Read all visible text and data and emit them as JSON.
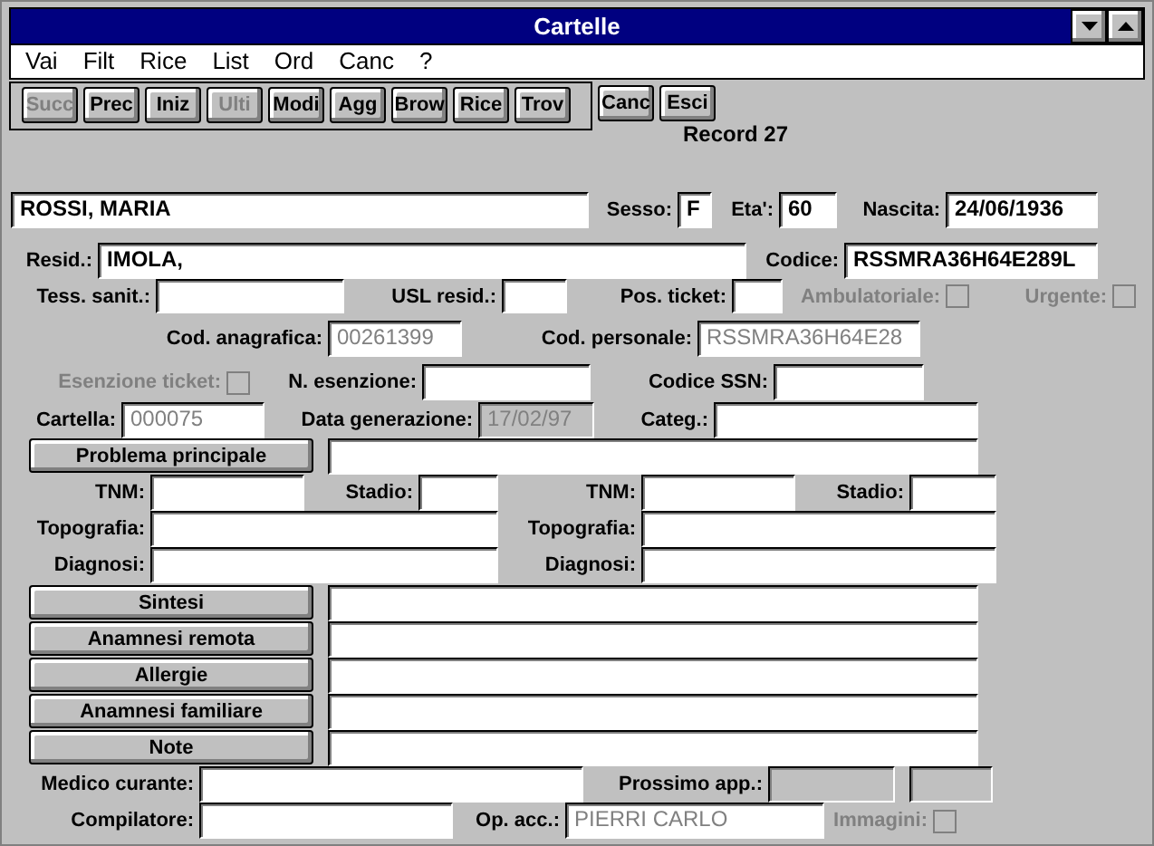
{
  "window": {
    "title": "Cartelle"
  },
  "menu": [
    {
      "label": "Vai"
    },
    {
      "label": "Filt"
    },
    {
      "label": "Rice"
    },
    {
      "label": "List"
    },
    {
      "label": "Ord"
    },
    {
      "label": "Canc"
    },
    {
      "label": "?"
    }
  ],
  "toolbar": {
    "grouped": [
      {
        "label": "Succ",
        "disabled": true
      },
      {
        "label": "Prec",
        "disabled": false
      },
      {
        "label": "Iniz",
        "disabled": false
      },
      {
        "label": "Ulti",
        "disabled": true
      },
      {
        "label": "Modi",
        "disabled": false
      },
      {
        "label": "Agg",
        "disabled": false
      },
      {
        "label": "Brow",
        "disabled": false
      },
      {
        "label": "Rice",
        "disabled": false
      },
      {
        "label": "Trov",
        "disabled": false
      }
    ],
    "separate": [
      {
        "label": "Canc",
        "disabled": false
      },
      {
        "label": "Esci",
        "disabled": false
      }
    ]
  },
  "record": "Record 27",
  "rows": [
    [
      {
        "kind": "field",
        "value": "ROSSI, MARIA"
      },
      {
        "kind": "label",
        "text": "Sesso:"
      },
      {
        "kind": "field",
        "value": "F"
      },
      {
        "kind": "label",
        "text": "Eta':"
      },
      {
        "kind": "field",
        "value": "60"
      },
      {
        "kind": "label",
        "text": "Nascita:"
      },
      {
        "kind": "field",
        "value": "24/06/1936"
      }
    ],
    [
      {
        "kind": "label",
        "text": "Resid.:"
      },
      {
        "kind": "field",
        "value": "IMOLA,"
      },
      {
        "kind": "label",
        "text": "Codice:"
      },
      {
        "kind": "field",
        "value": "RSSMRA36H64E289L"
      }
    ],
    [
      {
        "kind": "label",
        "text": "Tess. sanit.:"
      },
      {
        "kind": "field"
      },
      {
        "kind": "label",
        "text": "USL resid.:"
      },
      {
        "kind": "field"
      },
      {
        "kind": "label",
        "text": "Pos. ticket:"
      },
      {
        "kind": "field"
      },
      {
        "kind": "label",
        "text": "Ambulatoriale:",
        "disabled": true
      },
      {
        "kind": "checkbox",
        "checked": false,
        "disabled": true
      },
      {
        "kind": "label",
        "text": "Urgente:",
        "disabled": true
      },
      {
        "kind": "checkbox",
        "checked": false,
        "disabled": true
      }
    ],
    [
      {
        "kind": "label",
        "text": "Cod. anagrafica:"
      },
      {
        "kind": "field",
        "value": "00261399",
        "readonly": true
      },
      {
        "kind": "label",
        "text": "Cod. personale:"
      },
      {
        "kind": "field",
        "value": "RSSMRA36H64E28",
        "readonly": true
      }
    ],
    [
      {
        "kind": "label",
        "text": "Esenzione ticket:",
        "disabled": true
      },
      {
        "kind": "checkbox",
        "checked": false,
        "disabled": true
      },
      {
        "kind": "label",
        "text": "N. esenzione:"
      },
      {
        "kind": "field"
      },
      {
        "kind": "label",
        "text": "Codice SSN:"
      },
      {
        "kind": "field"
      }
    ],
    [
      {
        "kind": "label",
        "text": "Cartella:"
      },
      {
        "kind": "field",
        "value": "000075",
        "readonly": true
      },
      {
        "kind": "label",
        "text": "Data generazione:"
      },
      {
        "kind": "field",
        "value": "17/02/97",
        "disabled": true
      },
      {
        "kind": "label",
        "text": "Categ.:"
      },
      {
        "kind": "field"
      }
    ],
    [
      {
        "kind": "button",
        "label": "Problema principale"
      },
      {
        "kind": "field"
      }
    ],
    [
      {
        "kind": "label",
        "text": "TNM:"
      },
      {
        "kind": "field"
      },
      {
        "kind": "label",
        "text": "Stadio:"
      },
      {
        "kind": "field"
      },
      {
        "kind": "label",
        "text": "TNM:"
      },
      {
        "kind": "field"
      },
      {
        "kind": "label",
        "text": "Stadio:"
      },
      {
        "kind": "field"
      }
    ],
    [
      {
        "kind": "label",
        "text": "Topografia:"
      },
      {
        "kind": "field"
      },
      {
        "kind": "label",
        "text": "Topografia:"
      },
      {
        "kind": "field"
      }
    ],
    [
      {
        "kind": "label",
        "text": "Diagnosi:"
      },
      {
        "kind": "field"
      },
      {
        "kind": "label",
        "text": "Diagnosi:"
      },
      {
        "kind": "field"
      }
    ],
    [
      {
        "kind": "button",
        "label": "Sintesi"
      },
      {
        "kind": "field"
      }
    ],
    [
      {
        "kind": "button",
        "label": "Anamnesi remota"
      },
      {
        "kind": "field"
      }
    ],
    [
      {
        "kind": "button",
        "label": "Allergie"
      },
      {
        "kind": "field"
      }
    ],
    [
      {
        "kind": "button",
        "label": "Anamnesi familiare"
      },
      {
        "kind": "field"
      }
    ],
    [
      {
        "kind": "button",
        "label": "Note"
      },
      {
        "kind": "field"
      }
    ],
    [
      {
        "kind": "label",
        "text": "Medico curante:"
      },
      {
        "kind": "field"
      },
      {
        "kind": "label",
        "text": "Prossimo app.:"
      },
      {
        "kind": "field",
        "disabled": true
      },
      {
        "kind": "field",
        "disabled": true
      }
    ],
    [
      {
        "kind": "label",
        "text": "Compilatore:"
      },
      {
        "kind": "field"
      },
      {
        "kind": "label",
        "text": "Op. acc.:"
      },
      {
        "kind": "field",
        "value": "PIERRI CARLO",
        "readonly": true
      },
      {
        "kind": "label",
        "text": "Immagini:",
        "disabled": true
      },
      {
        "kind": "checkbox",
        "checked": false,
        "disabled": true
      }
    ]
  ]
}
